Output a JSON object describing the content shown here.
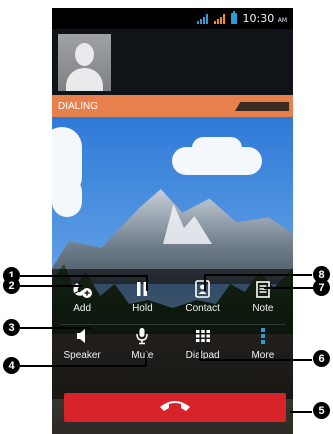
{
  "status_bar": {
    "time": "10:30",
    "ampm": "AM",
    "colors": {
      "signal1": "#2f9bd6",
      "signal2": "#f28c1e",
      "battery": "#2f9bd6"
    }
  },
  "call": {
    "status": "DIALING"
  },
  "controls": {
    "row1": [
      {
        "label": "Add",
        "icon": "add-call-icon"
      },
      {
        "label": "Hold",
        "icon": "pause-icon"
      },
      {
        "label": "Contact",
        "icon": "contact-icon"
      },
      {
        "label": "Note",
        "icon": "note-icon"
      }
    ],
    "row2": [
      {
        "label": "Speaker",
        "icon": "speaker-icon"
      },
      {
        "label": "Mute",
        "icon": "microphone-icon"
      },
      {
        "label": "Dialpad",
        "icon": "dialpad-icon"
      },
      {
        "label": "More",
        "icon": "more-vertical-icon"
      }
    ],
    "end_call_icon": "end-call-icon",
    "end_call_color": "#d8232a"
  },
  "callouts": [
    "1",
    "2",
    "3",
    "4",
    "5",
    "6",
    "7",
    "8"
  ]
}
